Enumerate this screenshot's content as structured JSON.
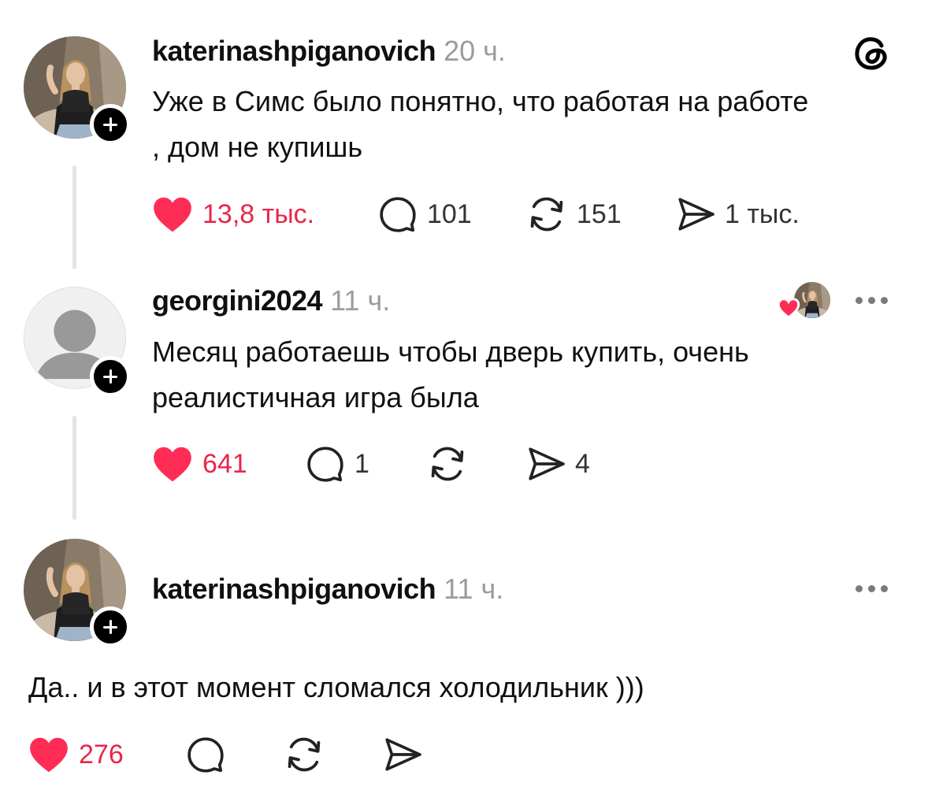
{
  "app_icon": "threads-logo-icon",
  "posts": [
    {
      "username": "katerinashpiganovich",
      "time": "20 ч.",
      "text_lines": [
        "Уже в Симс было понятно, что работая на работе",
        ", дом не купишь"
      ],
      "likes": "13,8 тыс.",
      "comments": "101",
      "reposts": "151",
      "shares": "1 тыс."
    },
    {
      "username": "georgini2024",
      "time": "11 ч.",
      "text_lines": [
        "Месяц работаешь чтобы дверь купить, очень",
        "реалистичная игра была"
      ],
      "likes": "641",
      "comments": "1",
      "reposts": "",
      "shares": "4"
    },
    {
      "username": "katerinashpiganovich",
      "time": "11 ч.",
      "text_lines": [
        "Да.. и в этот момент сломался холодильник )))"
      ],
      "likes": "276",
      "comments": "",
      "reposts": "",
      "shares": ""
    }
  ],
  "colors": {
    "like": "#ff2c55",
    "liked_text": "#e8264a",
    "muted": "#9c9c9c"
  }
}
